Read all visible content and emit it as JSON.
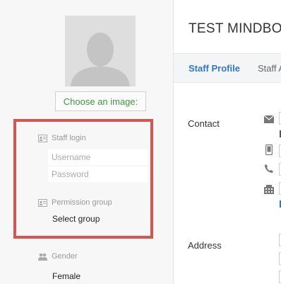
{
  "profile": {
    "choose_image_label": "Choose an image:"
  },
  "staff_login": {
    "label": "Staff login",
    "username_placeholder": "Username",
    "password_placeholder": "Password"
  },
  "permission_group": {
    "label": "Permission group",
    "value": "Select group"
  },
  "gender": {
    "label": "Gender",
    "value": "Female"
  },
  "main": {
    "title": "TEST MINDBODY",
    "tabs": [
      {
        "label": "Staff Profile"
      },
      {
        "label": "Staff A"
      }
    ],
    "sections": {
      "contact": "Contact",
      "address": "Address"
    }
  },
  "colors": {
    "accent_blue": "#2f78c4",
    "highlight_red": "#d9534f",
    "button_green": "#3d9a3d"
  }
}
